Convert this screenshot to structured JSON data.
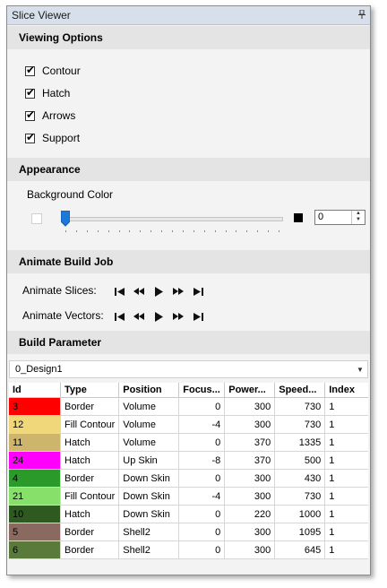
{
  "window": {
    "title": "Slice Viewer",
    "pin_icon": "pin-icon"
  },
  "viewing_options": {
    "header": "Viewing Options",
    "items": [
      {
        "label": "Contour",
        "checked": true
      },
      {
        "label": "Hatch",
        "checked": true
      },
      {
        "label": "Arrows",
        "checked": true
      },
      {
        "label": "Support",
        "checked": true
      }
    ]
  },
  "appearance": {
    "header": "Appearance",
    "background_color_label": "Background Color",
    "slider_value": 0,
    "spin_value": "0",
    "min_swatch_color": "#ffffff",
    "max_swatch_color": "#000000"
  },
  "animate": {
    "header": "Animate Build Job",
    "slices_label": "Animate Slices:",
    "vectors_label": "Animate Vectors:",
    "controls": [
      "skip-start-icon",
      "rewind-icon",
      "play-icon",
      "fast-forward-icon",
      "skip-end-icon"
    ]
  },
  "build_parameter": {
    "header": "Build Parameter",
    "design_value": "0_Design1",
    "columns": [
      "Id",
      "Type",
      "Position",
      "Focus...",
      "Power...",
      "Speed...",
      "Index"
    ],
    "rows": [
      {
        "id": "3",
        "color": "#ff0000",
        "type": "Border",
        "position": "Volume",
        "focus": "0",
        "power": "300",
        "speed": "730",
        "index": "1"
      },
      {
        "id": "12",
        "color": "#f0d87a",
        "type": "Fill Contour",
        "position": "Volume",
        "focus": "-4",
        "power": "300",
        "speed": "730",
        "index": "1"
      },
      {
        "id": "11",
        "color": "#cdb56c",
        "type": "Hatch",
        "position": "Volume",
        "focus": "0",
        "power": "370",
        "speed": "1335",
        "index": "1"
      },
      {
        "id": "24",
        "color": "#ff00ff",
        "type": "Hatch",
        "position": "Up Skin",
        "focus": "-8",
        "power": "370",
        "speed": "500",
        "index": "1"
      },
      {
        "id": "4",
        "color": "#2a9a2a",
        "type": "Border",
        "position": "Down Skin",
        "focus": "0",
        "power": "300",
        "speed": "430",
        "index": "1"
      },
      {
        "id": "21",
        "color": "#86e06a",
        "type": "Fill Contour",
        "position": "Down Skin",
        "focus": "-4",
        "power": "300",
        "speed": "730",
        "index": "1"
      },
      {
        "id": "10",
        "color": "#2e5a22",
        "type": "Hatch",
        "position": "Down Skin",
        "focus": "0",
        "power": "220",
        "speed": "1000",
        "index": "1"
      },
      {
        "id": "5",
        "color": "#8a6a60",
        "type": "Border",
        "position": "Shell2",
        "focus": "0",
        "power": "300",
        "speed": "1095",
        "index": "1"
      },
      {
        "id": "6",
        "color": "#5a7a3c",
        "type": "Border",
        "position": "Shell2",
        "focus": "0",
        "power": "300",
        "speed": "645",
        "index": "1"
      }
    ]
  }
}
